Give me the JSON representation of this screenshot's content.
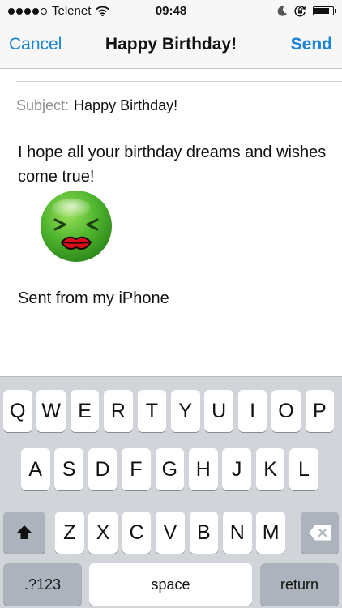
{
  "status_bar": {
    "carrier": "Telenet",
    "time": "09:48",
    "battery_level": 0.85
  },
  "nav": {
    "cancel_label": "Cancel",
    "title": "Happy Birthday!",
    "send_label": "Send"
  },
  "compose": {
    "subject_label": "Subject:",
    "subject_value": "Happy Birthday!",
    "body_text": "I hope all your birthday dreams and wishes come true!",
    "emoji": "kissing-face-emoji",
    "signature": "Sent from my iPhone"
  },
  "keyboard": {
    "row1": [
      "Q",
      "W",
      "E",
      "R",
      "T",
      "Y",
      "U",
      "I",
      "O",
      "P"
    ],
    "row2": [
      "A",
      "S",
      "D",
      "F",
      "G",
      "H",
      "J",
      "K",
      "L"
    ],
    "row3": [
      "Z",
      "X",
      "C",
      "V",
      "B",
      "N",
      "M"
    ],
    "shift_icon": "shift-arrow-icon",
    "delete_icon": "backspace-icon",
    "numbers_label": ".?123",
    "space_label": "space",
    "return_label": "return"
  },
  "colors": {
    "accent": "#1a82d8",
    "keyboard_bg": "#d1d4d9",
    "dark_key": "#acb3bc"
  }
}
